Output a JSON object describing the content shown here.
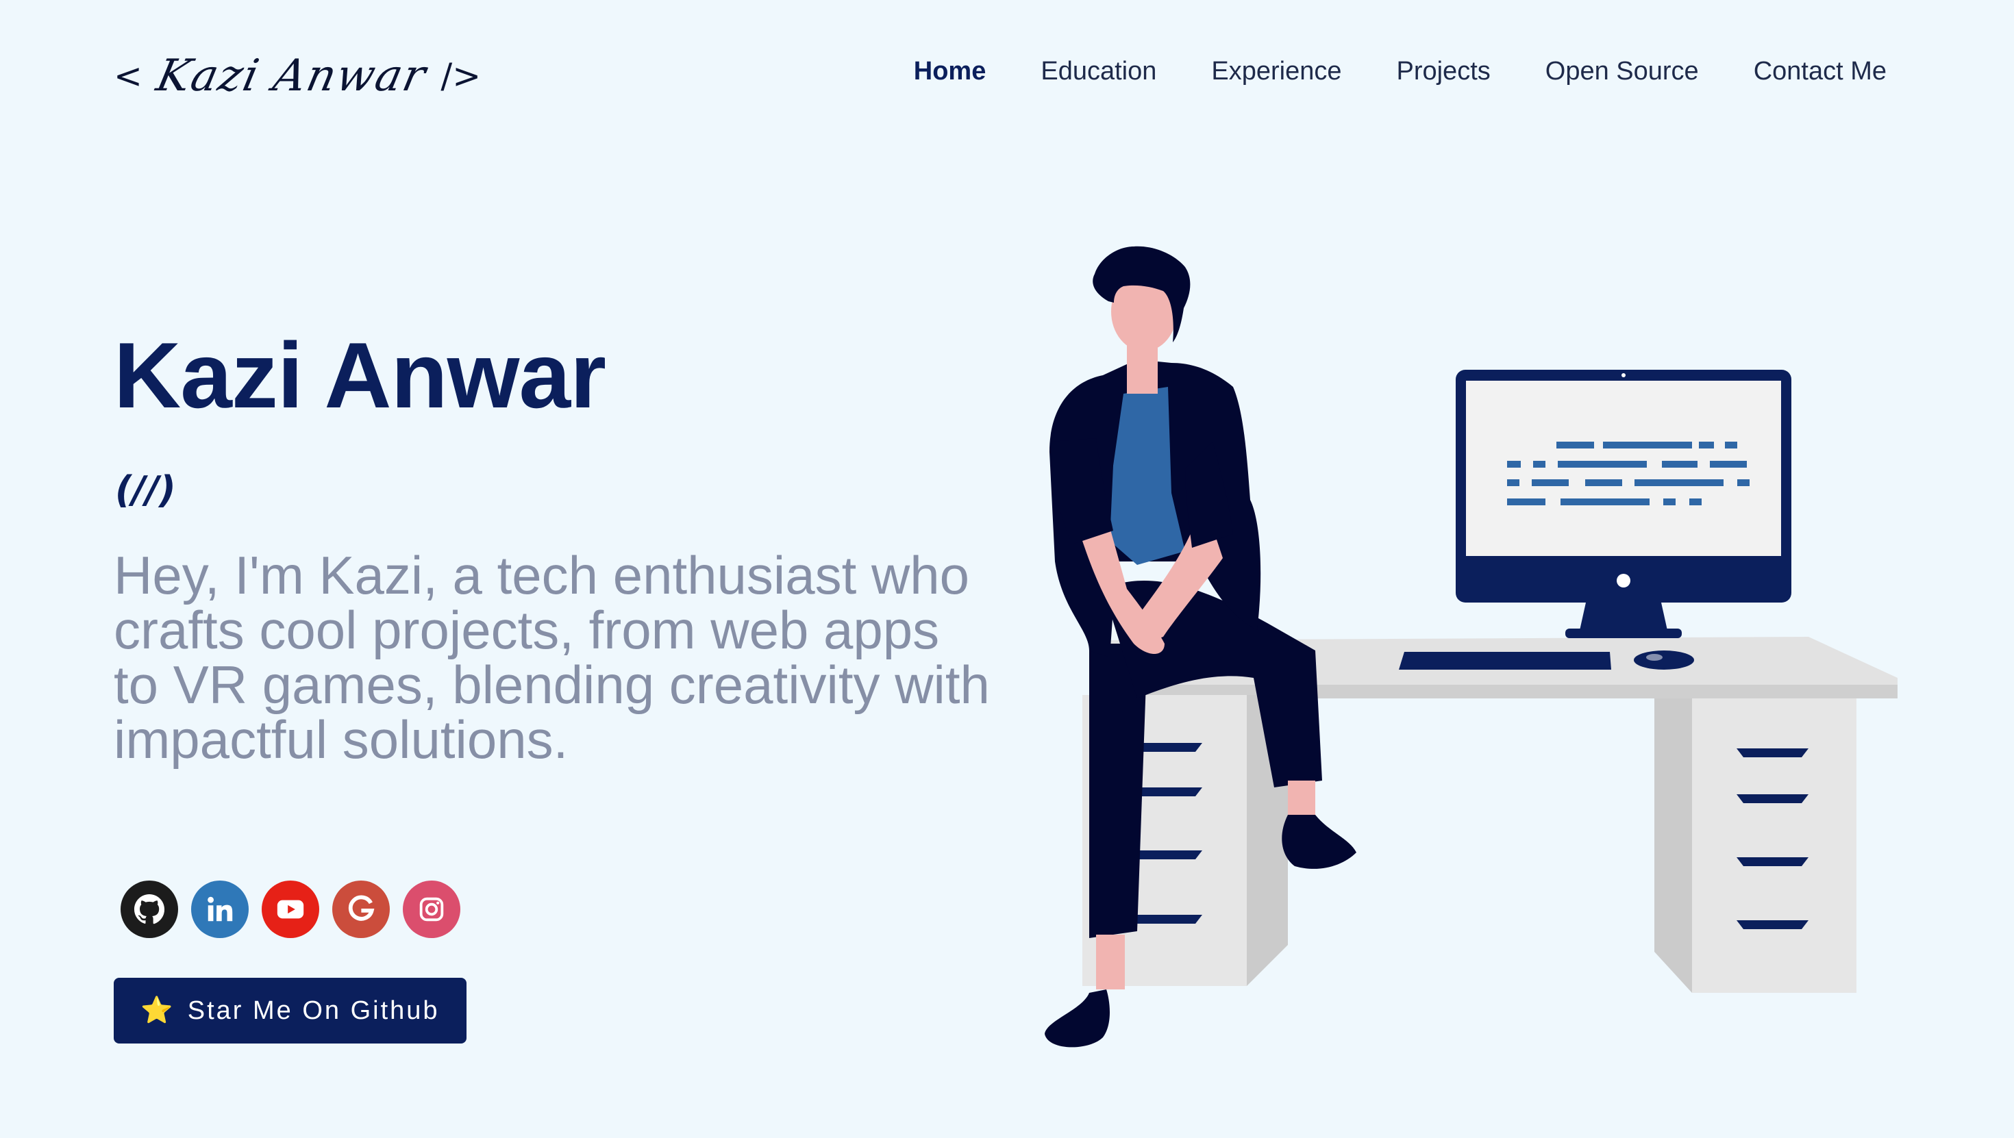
{
  "header": {
    "logo": {
      "open_bracket": "<",
      "script_text": "Kazi Anwar",
      "close_bracket": "/>"
    },
    "nav": [
      {
        "label": "Home",
        "active": true
      },
      {
        "label": "Education",
        "active": false
      },
      {
        "label": "Experience",
        "active": false
      },
      {
        "label": "Projects",
        "active": false
      },
      {
        "label": "Open Source",
        "active": false
      },
      {
        "label": "Contact Me",
        "active": false
      }
    ]
  },
  "hero": {
    "name": "Kazi Anwar",
    "wave": "(//)",
    "bio": "Hey, I'm Kazi, a tech enthusiast who crafts cool projects, from web apps to VR games, blending creativity with impactful solutions.",
    "socials": [
      {
        "icon": "github-icon",
        "color": "#1c1c1c"
      },
      {
        "icon": "linkedin-icon",
        "color": "#2f78b8"
      },
      {
        "icon": "youtube-icon",
        "color": "#e62117"
      },
      {
        "icon": "google-icon",
        "color": "#cb4d3c"
      },
      {
        "icon": "instagram-icon",
        "color": "#db4e6d"
      }
    ],
    "cta": {
      "star": "⭐",
      "label": "Star Me On Github"
    }
  },
  "colors": {
    "background": "#eff8fd",
    "primary": "#0b1f5c",
    "muted_text": "#868fa6"
  }
}
